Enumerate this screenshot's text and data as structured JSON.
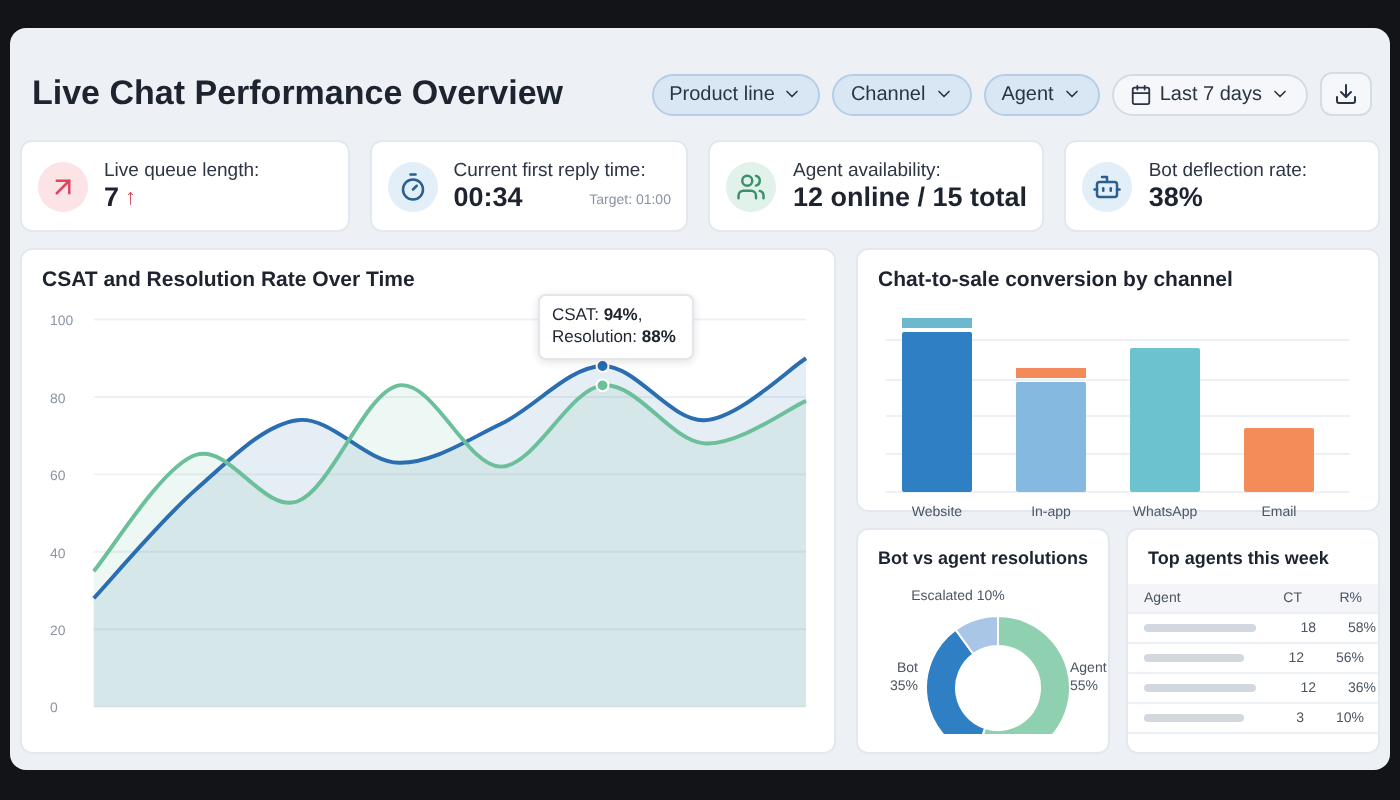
{
  "title": "Live Chat Performance Overview",
  "filters": [
    {
      "label": "Product line",
      "kind": "dropdown",
      "active": true
    },
    {
      "label": "Channel",
      "kind": "dropdown",
      "active": true
    },
    {
      "label": "Agent",
      "kind": "dropdown",
      "active": true
    },
    {
      "label": "Last 7 days",
      "kind": "date",
      "active": false
    }
  ],
  "kpis": [
    {
      "kind": "queue",
      "label": "Live queue length:",
      "value": "7",
      "trend": "↑"
    },
    {
      "kind": "timer",
      "label": "Current first reply time:",
      "value": "00:34",
      "note": "Target: 01:00"
    },
    {
      "kind": "agents",
      "label": "Agent availability:",
      "value": "12 online / 15 total"
    },
    {
      "kind": "bot",
      "label": "Bot deflection rate:",
      "value": "38%"
    }
  ],
  "trend_card": {
    "title": "CSAT and Resolution Rate Over Time",
    "tooltip": "CSAT: **94%**, Resolution: **88%**",
    "chart_data": {
      "type": "area",
      "grid": true,
      "ylim": [
        0,
        100
      ],
      "yticks": [
        0,
        20,
        40,
        60,
        80,
        100
      ],
      "series": [
        {
          "color": "#2a6db0",
          "values": [
            28,
            56,
            74,
            63,
            73,
            88,
            74,
            90
          ]
        },
        {
          "color": "#6bbf9a",
          "values": [
            35,
            65,
            53,
            83,
            62,
            83,
            68,
            79
          ]
        }
      ]
    }
  },
  "conversion_card": {
    "title": "Chat-to-sale conversion by channel",
    "channels": [
      {
        "label": "Website"
      },
      {
        "label": "In-app"
      },
      {
        "label": "WhatsApp"
      },
      {
        "label": "Email"
      }
    ]
  },
  "resolutions_card": {
    "title": "Bot vs agent resolutions",
    "chart_data": {
      "type": "donut",
      "categories": [
        "Agent",
        "Bot",
        "Escalated"
      ],
      "values": [
        55,
        35,
        10
      ],
      "value_labels": [
        "55%",
        "35%",
        "10%"
      ],
      "colors": [
        "#8fd0b0",
        "#2f7fc4",
        "#a9c6e6"
      ],
      "data_labels": true
    }
  },
  "agents_card": {
    "title": "Top agents this week",
    "columns": [
      "Agent",
      "CT",
      "R%"
    ],
    "rows": [
      {
        "ct": "18",
        "rate": "58%"
      },
      {
        "ct": "12",
        "rate": "56%"
      },
      {
        "ct": "12",
        "rate": "36%"
      },
      {
        "ct": "3",
        "rate": "10%"
      }
    ]
  }
}
